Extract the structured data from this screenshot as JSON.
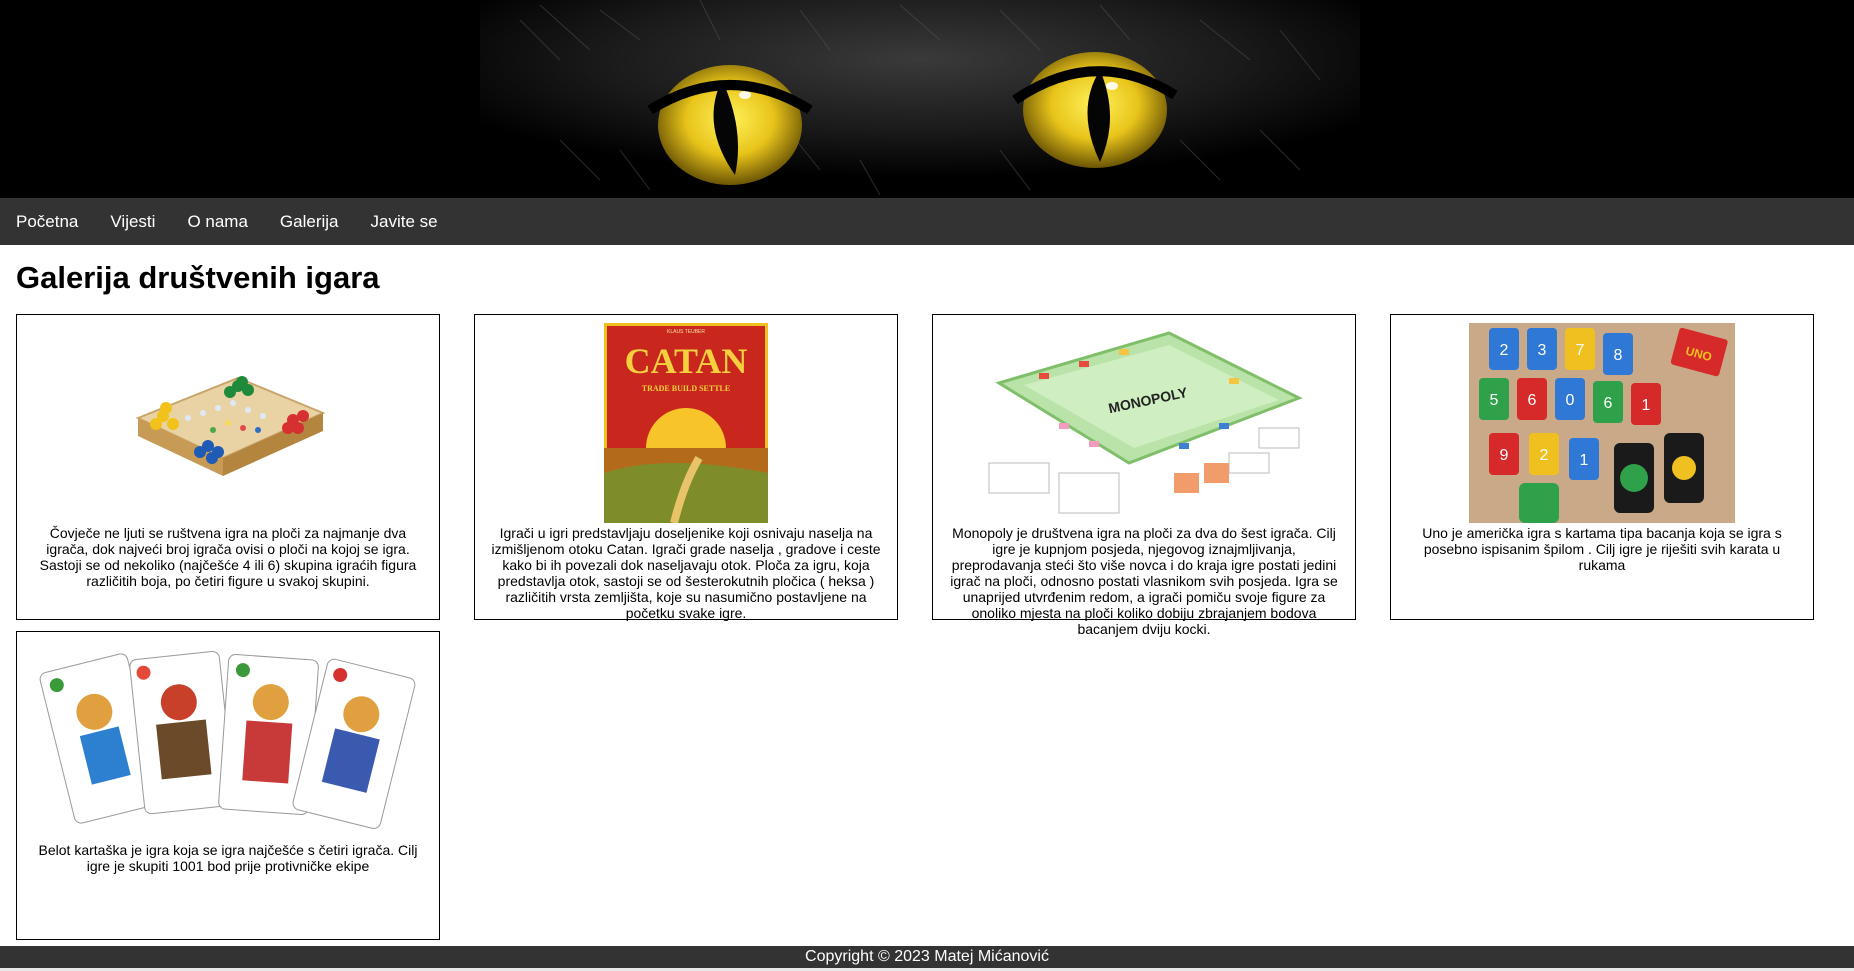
{
  "nav": {
    "items": [
      "Početna",
      "Vijesti",
      "O nama",
      "Galerija",
      "Javite se"
    ]
  },
  "main": {
    "title": "Galerija društvenih igara",
    "cards": [
      {
        "image": "ludo-board-image",
        "description": "Čovječe ne ljuti se ruštvena igra na ploči za najmanje dva igrača, dok najveći broj igrača ovisi o ploči na kojoj se igra. Sastoji se od nekoliko (najčešće 4 ili 6) skupina igraćih figura različitih boja, po četiri figure u svakoj skupini."
      },
      {
        "image": "catan-box-image",
        "box_title": "CATAN",
        "box_subtitle": "TRADE BUILD SETTLE",
        "box_top": "KLAUS TEUBER",
        "description": "Igrači u igri predstavljaju doseljenike koji osnivaju naselja na izmišljenom otoku Catan. Igrači grade naselja , gradove i ceste kako bi ih povezali dok naseljavaju otok. Ploča za igru, koja predstavlja otok, sastoji se od šesterokutnih pločica ( heksa ) različitih vrsta zemljišta, koje su nasumično postavljene na početku svake igre."
      },
      {
        "image": "monopoly-board-image",
        "board_label": "MONOPOLY",
        "description": "Monopoly je društvena igra na ploči za dva do šest igrača. Cilj igre je kupnjom posjeda, njegovog iznajmljivanja, preprodavanja steći što više novca i do kraja igre postati jedini igrač na ploči, odnosno postati vlasnikom svih posjeda. Igra se unaprijed utvrđenim redom, a igrači pomiču svoje figure za onoliko mjesta na ploči koliko dobiju zbrajanjem bodova bacanjem dviju kocki."
      },
      {
        "image": "uno-cards-image",
        "card_numbers": [
          "2",
          "3",
          "7",
          "8",
          "5",
          "6",
          "0",
          "6",
          "1",
          "9",
          "2",
          "1"
        ],
        "box_label": "UNO",
        "description": "Uno je američka igra s kartama tipa bacanja koja se igra s posebno ispisanim špilom . Cilj igre je riješiti svih karata u rukama"
      },
      {
        "image": "belot-cards-image",
        "description": "Belot kartaška je igra koja se igra najčešće s četiri igrača. Cilj igre je skupiti 1001 bod prije protivničke ekipe"
      }
    ]
  },
  "footer": {
    "copyright": "Copyright © 2023 Matej Mićanović"
  },
  "colors": {
    "nav_bg": "#333333",
    "footer_bg": "#333333",
    "banner_bg": "#000000",
    "text": "#000000"
  }
}
